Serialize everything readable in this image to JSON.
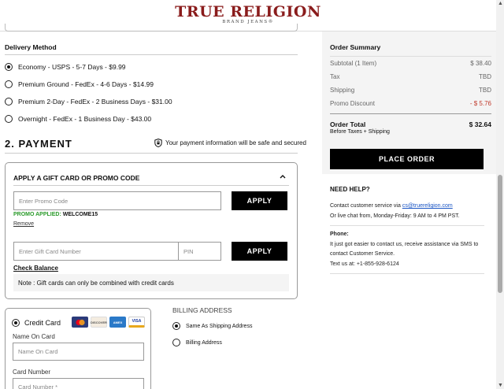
{
  "header": {
    "logo_main": "TRUE RELIGION",
    "logo_sub": "BRAND JEANS®"
  },
  "delivery": {
    "title": "Delivery Method",
    "options": [
      {
        "label": "Economy - USPS - 5-7 Days - $9.99",
        "selected": true
      },
      {
        "label": "Premium Ground - FedEx - 4-6 Days - $14.99",
        "selected": false
      },
      {
        "label": "Premium 2-Day - FedEx - 2 Business Days - $31.00",
        "selected": false
      },
      {
        "label": "Overnight - FedEx - 1 Business Day - $43.00",
        "selected": false
      }
    ]
  },
  "payment": {
    "title": "2. PAYMENT",
    "secure_text": "Your payment information will be safe and secured"
  },
  "promo": {
    "heading": "APPLY A GIFT CARD OR PROMO CODE",
    "promo_placeholder": "Enter Promo Code",
    "apply_label": "APPLY",
    "applied_label": "PROMO APPLIED:",
    "applied_code": "WELCOME15",
    "remove_label": "Remove",
    "gift_placeholder": "Enter Gift Card Number",
    "pin_placeholder": "PIN",
    "apply_gift_label": "APPLY",
    "check_balance": "Check Balance",
    "note": "Note : Gift cards can only be combined with credit cards"
  },
  "credit_card": {
    "label": "Credit Card",
    "selected": true,
    "cards": [
      "mastercard",
      "discover",
      "amex",
      "visa"
    ],
    "name_label": "Name On Card",
    "name_placeholder": "Name On Card",
    "number_label": "Card Number",
    "number_placeholder": "Card Number *"
  },
  "billing": {
    "title": "BILLING ADDRESS",
    "options": [
      {
        "label": "Same As Shipping Address",
        "selected": true
      },
      {
        "label": "Billing Address",
        "selected": false
      }
    ]
  },
  "summary": {
    "title": "Order Summary",
    "rows": [
      {
        "label": "Subtotal (1 Item)",
        "value": "$ 38.40"
      },
      {
        "label": "Tax",
        "value": "TBD"
      },
      {
        "label": "Shipping",
        "value": "TBD"
      },
      {
        "label": "Promo Discount",
        "value": "- $ 5.76"
      }
    ],
    "total_label": "Order Total",
    "total_value": "$ 32.64",
    "total_sub": "Before Taxes + Shipping",
    "place_order": "PLACE ORDER"
  },
  "help": {
    "title": "NEED HELP?",
    "contact_prefix": "Contact customer service via ",
    "email": "cs@truereligion.com",
    "chat": "Or live chat from, Monday-Friday: 9 AM to 4 PM PST.",
    "phone_title": "Phone:",
    "phone_text1": "It just got easier to contact us, receive assistance via SMS to",
    "phone_text2": "contact Customer Service.",
    "text_us": "Text us at: +1-855-928-6124"
  },
  "colors": {
    "brand": "#8a1c1c",
    "promo_green": "#2a9a2a",
    "discount_red": "#c0392b",
    "link_blue": "#1a55c4"
  }
}
